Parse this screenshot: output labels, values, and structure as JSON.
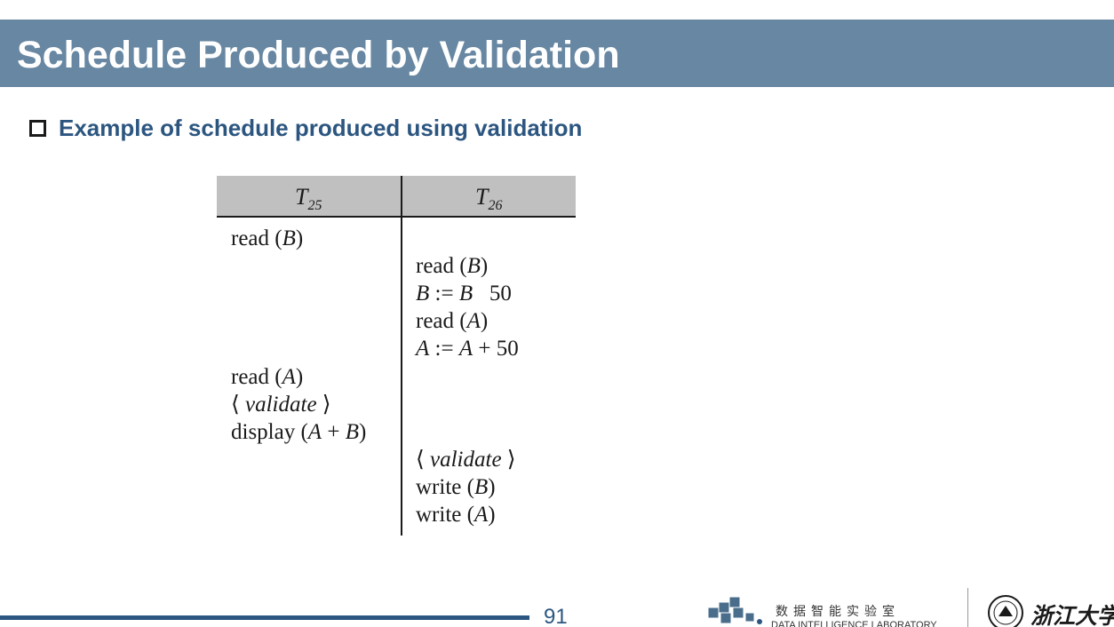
{
  "slide": {
    "title": "Schedule Produced by Validation",
    "bullet": "Example of schedule produced using validation",
    "page_number": "91"
  },
  "table": {
    "columns": [
      {
        "name": "T",
        "sub": "25"
      },
      {
        "name": "T",
        "sub": "26"
      }
    ],
    "rows": [
      {
        "t25": "read (B)",
        "t26": ""
      },
      {
        "t25": "",
        "t26": "read (B)"
      },
      {
        "t25": "",
        "t26": "B := B   50"
      },
      {
        "t25": "",
        "t26": "read (A)"
      },
      {
        "t25": "",
        "t26": "A := A + 50"
      },
      {
        "t25": "read (A)",
        "t26": ""
      },
      {
        "t25": "⟨ validate ⟩",
        "t26": ""
      },
      {
        "t25": "display (A + B)",
        "t26": ""
      },
      {
        "t25": "",
        "t26": "⟨ validate ⟩"
      },
      {
        "t25": "",
        "t26": "write (B)"
      },
      {
        "t25": "",
        "t26": "write (A)"
      }
    ]
  },
  "footer": {
    "lab_name_cn": "数据智能实验室",
    "lab_name_en": "DATA INTELLIGENCE LABORATORY",
    "university_name_cn": "浙江大学",
    "lab_logo_icon": "cubes-logo-icon",
    "university_seal_icon": "zju-seal-icon"
  },
  "colors": {
    "title_bar": "#6787a2",
    "accent_blue": "#2c5680",
    "table_header": "#c0c0c0"
  }
}
